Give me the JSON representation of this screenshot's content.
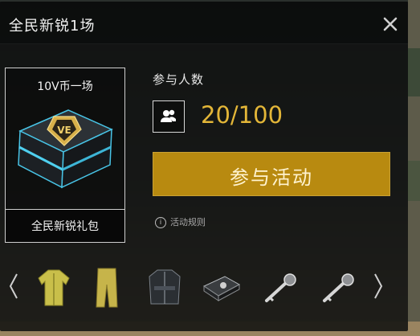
{
  "dialog": {
    "title": "全民新锐1场",
    "close_icon": "close-icon"
  },
  "gift": {
    "ticket_label": "10V币一场",
    "name": "全民新锐礼包",
    "chest_icon": "v-chest-icon"
  },
  "participation": {
    "label": "参与人数",
    "count": "20/100",
    "count_color": "#e3b638",
    "icon": "people-icon"
  },
  "join_button": {
    "label": "参与活动",
    "color": "#b88a10"
  },
  "rules": {
    "label": "活动规则",
    "icon": "info-icon"
  },
  "reward_items": [
    {
      "icon": "jacket-icon"
    },
    {
      "icon": "pants-icon"
    },
    {
      "icon": "vest-icon"
    },
    {
      "icon": "case-icon"
    },
    {
      "icon": "key-icon"
    },
    {
      "icon": "key-icon"
    }
  ]
}
